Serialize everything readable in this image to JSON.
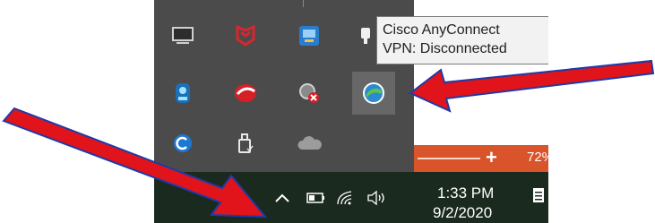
{
  "tooltip": {
    "line1": "Cisco AnyConnect",
    "line2": "VPN: Disconnected"
  },
  "background_window": {
    "zoom_plus": "+",
    "zoom_percent": "72%"
  },
  "taskbar": {
    "time": "1:33 PM",
    "date": "9/2/2020"
  },
  "tray_icons": [
    {
      "name": "display-icon",
      "row": 1
    },
    {
      "name": "mcafee-icon",
      "row": 1
    },
    {
      "name": "network-app-icon",
      "row": 1
    },
    {
      "name": "usb-eject-icon",
      "row": 1
    },
    {
      "name": "bluetooth-app-icon",
      "row": 2
    },
    {
      "name": "red-swoosh-app-icon",
      "row": 2
    },
    {
      "name": "disconnected-error-icon",
      "row": 2
    },
    {
      "name": "cisco-anyconnect-icon",
      "row": 2
    },
    {
      "name": "rotating-c-icon",
      "row": 3
    },
    {
      "name": "usb-drive-check-icon",
      "row": 3
    },
    {
      "name": "onedrive-cloud-icon",
      "row": 3
    }
  ],
  "annotations": {
    "arrow_color": "#e0141a",
    "arrow_outline": "#1f3aa8"
  }
}
